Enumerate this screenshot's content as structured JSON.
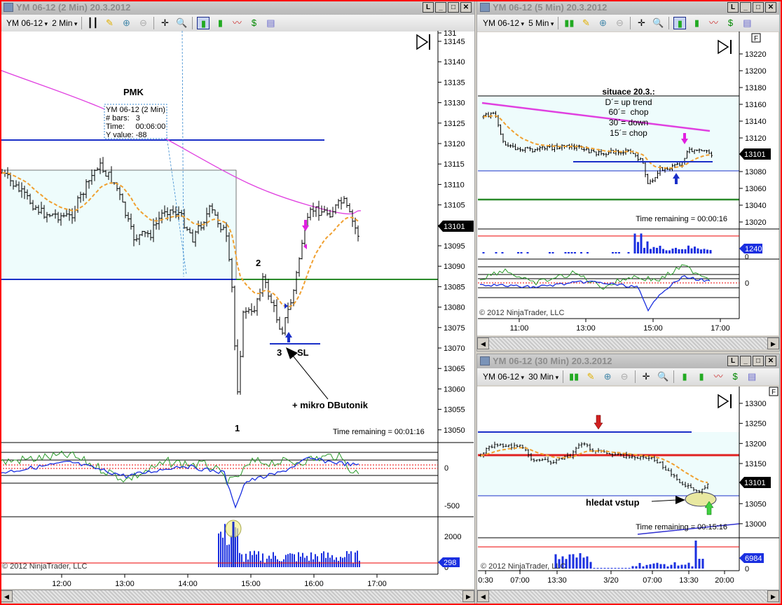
{
  "left_window": {
    "title": "YM 06-12 (2 Min)  20.3.2012",
    "instrument": "YM 06-12",
    "interval": "2 Min",
    "price_ticks": [
      "131",
      "13145",
      "13140",
      "13135",
      "13130",
      "13125",
      "13120",
      "13115",
      "13110",
      "13105",
      "13100",
      "13095",
      "13090",
      "13085",
      "13080",
      "13075",
      "13070",
      "13065",
      "13060",
      "13055",
      "13050"
    ],
    "indicator_ticks": [
      "0",
      "-500"
    ],
    "volume_ticks": [
      "2000",
      "0"
    ],
    "time_ticks": [
      "12:00",
      "13:00",
      "14:00",
      "15:00",
      "16:00",
      "17:00"
    ],
    "last_price": "13101",
    "last_volume": "298",
    "time_remaining": "Time remaining = 00:01:16",
    "copyright": "© 2012 NinjaTrader, LLC",
    "annotations": {
      "pmk": "PMK",
      "p1": "1",
      "p2": "2",
      "p3": "3",
      "sl": "SL",
      "note": "+ mikro DButonik"
    },
    "tooltip": {
      "line1": "YM 06-12 (2 Min)",
      "line2": "# bars:   3",
      "line3": "Time:     00:06:00",
      "line4": "Y value: -88"
    }
  },
  "top_right_window": {
    "title": "YM 06-12 (5 Min)  20.3.2012",
    "instrument": "YM 06-12",
    "interval": "5 Min",
    "price_ticks": [
      "13220",
      "13200",
      "13180",
      "13160",
      "13140",
      "13120",
      "13080",
      "13060",
      "13040",
      "13020"
    ],
    "osc_tick": "0",
    "vol_tick": "0",
    "time_ticks": [
      "11:00",
      "13:00",
      "15:00",
      "17:00"
    ],
    "last_price": "13101",
    "last_volume": "1240",
    "time_remaining": "Time remaining = 00:00:16",
    "copyright": "© 2012 NinjaTrader, LLC",
    "f_label": "F",
    "notes": {
      "heading": "situace 20.3.:",
      "l1": "D´= up trend",
      "l2": "60´=  chop",
      "l3": "30´= down",
      "l4": "15´= chop"
    }
  },
  "bottom_right_window": {
    "title": "YM 06-12 (30 Min)  20.3.2012",
    "instrument": "YM 06-12",
    "interval": "30 Min",
    "price_ticks": [
      "13300",
      "13250",
      "13200",
      "13150",
      "13050",
      "13000"
    ],
    "vol_tick": "0",
    "time_ticks": [
      "0:30",
      "07:00",
      "13:30",
      "3/20",
      "07:00",
      "13:30",
      "20:00"
    ],
    "last_price": "13101",
    "last_volume": "6984",
    "time_remaining": "Time remaining = 00:15:16",
    "copyright": "© 2012 NinjaTrader, LLC",
    "f_label": "F",
    "note": "hledat vstup"
  },
  "window_buttons": {
    "link": "L",
    "min": "_",
    "max": "□",
    "close": "✕"
  },
  "colors": {
    "frame": "#ff0000",
    "cyan_zone": "#eefcfc",
    "blue_line": "#1a2fc8",
    "green_line": "#2a8a2a",
    "magenta": "#e040e0",
    "orange_ema": "#f0a030",
    "volume": "#0000ff"
  }
}
